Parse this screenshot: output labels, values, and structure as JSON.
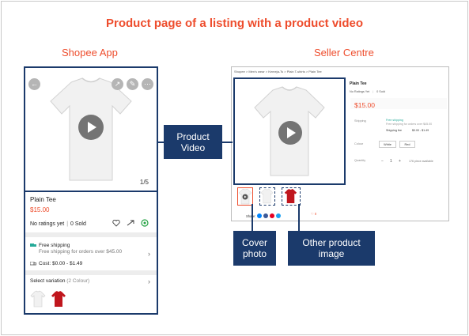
{
  "title": "Product page of a listing with a product video",
  "app": {
    "heading": "Shopee App",
    "counter": "1/5",
    "product_name": "Plain Tee",
    "price": "$15.00",
    "ratings": "No ratings yet",
    "sold": "0 Sold",
    "shipping_title": "Free shipping",
    "shipping_sub": "Free shipping for orders over $45.00",
    "cost": "Cost: $0.00 - $1.49",
    "variation_label": "Select variation",
    "variation_count": "(2 Colour)"
  },
  "seller": {
    "heading": "Seller Centre",
    "breadcrumb": "Shopee > Men's wear > Kemeja-Ts > Plain T-shirts > Plain Tee",
    "product_name": "Plain Tee",
    "ratings": "No Ratings Yet",
    "sold": "0 Sold",
    "price": "$15.00",
    "shipping_label": "Shipping",
    "free_shipping": "Free shipping",
    "free_shipping_sub": "Free shipping for orders over $45.00",
    "shipping_fee_label": "Shipping fee",
    "shipping_fee": "$0.00 - $1.49",
    "colour_label": "Colour",
    "colour_options": [
      "White",
      "Red"
    ],
    "quantity_label": "Quantity",
    "quantity_value": "1",
    "pieces": "176 piece available",
    "share_label": "Share:",
    "favourite_count": "0"
  },
  "labels": {
    "product_video": "Product Video",
    "cover_photo": "Cover photo",
    "other_image": "Other product image"
  },
  "colors": {
    "accent": "#ee4d2d",
    "navy": "#1b3a6b"
  }
}
